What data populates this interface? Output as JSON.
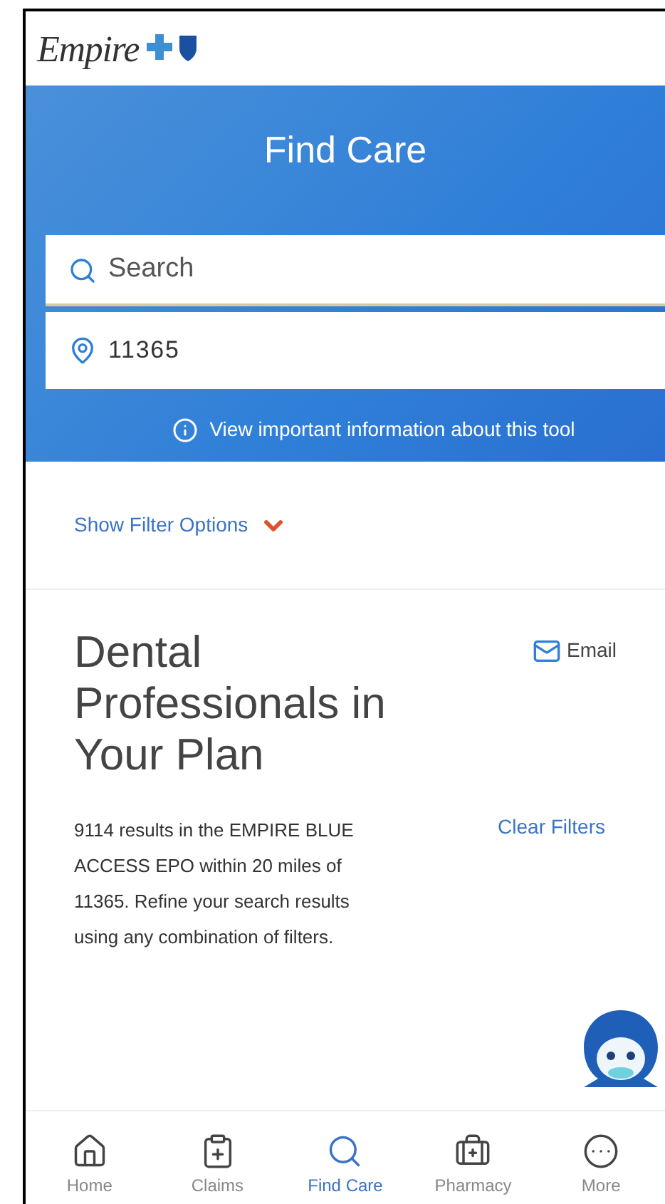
{
  "header": {
    "logo_text": "Empire"
  },
  "hero": {
    "title": "Find Care",
    "search": {
      "placeholder": "Search"
    },
    "location": {
      "value": "11365"
    },
    "info_link": "View important information about this tool"
  },
  "filters": {
    "label": "Show Filter Options",
    "expanded": false
  },
  "results": {
    "heading": "Dental Professionals in Your Plan",
    "email": "Email",
    "summary": "9114 results in the EMPIRE BLUE ACCESS EPO within 20 miles of 11365. Refine your search results using any combination of filters.",
    "clear": "Clear Filters"
  },
  "nav": [
    {
      "label": "Home",
      "kind": "home",
      "selected": false
    },
    {
      "label": "Claims",
      "kind": "claims",
      "selected": false
    },
    {
      "label": "Find Care",
      "kind": "search",
      "selected": true
    },
    {
      "label": "Pharmacy",
      "kind": "pharmacy",
      "selected": false
    },
    {
      "label": "More",
      "kind": "more",
      "selected": false
    }
  ]
}
